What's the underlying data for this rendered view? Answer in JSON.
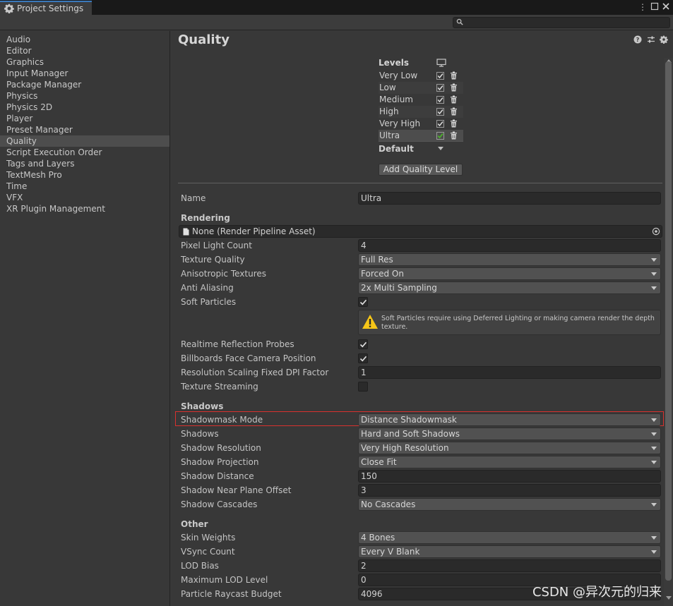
{
  "window": {
    "tab_title": "Project Settings",
    "tab_icon": "gear-icon",
    "menu_icon": "kebab-menu-icon",
    "maximize_icon": "maximize-icon",
    "close_icon": "close-icon"
  },
  "search": {
    "placeholder": "",
    "icon": "search-icon"
  },
  "sidebar": {
    "items": [
      {
        "label": "Audio"
      },
      {
        "label": "Editor"
      },
      {
        "label": "Graphics"
      },
      {
        "label": "Input Manager"
      },
      {
        "label": "Package Manager"
      },
      {
        "label": "Physics"
      },
      {
        "label": "Physics 2D"
      },
      {
        "label": "Player"
      },
      {
        "label": "Preset Manager"
      },
      {
        "label": "Quality",
        "selected": true
      },
      {
        "label": "Script Execution Order"
      },
      {
        "label": "Tags and Layers"
      },
      {
        "label": "TextMesh Pro"
      },
      {
        "label": "Time"
      },
      {
        "label": "VFX"
      },
      {
        "label": "XR Plugin Management"
      }
    ]
  },
  "main": {
    "title": "Quality",
    "header_icons": [
      "help-icon",
      "presets-icon",
      "settings-icon"
    ],
    "levels": {
      "title": "Levels",
      "rows": [
        {
          "name": "Very Low",
          "checked": true
        },
        {
          "name": "Low",
          "checked": true
        },
        {
          "name": "Medium",
          "checked": true
        },
        {
          "name": "High",
          "checked": true
        },
        {
          "name": "Very High",
          "checked": true
        },
        {
          "name": "Ultra",
          "checked": true,
          "selected": true
        }
      ],
      "default_label": "Default",
      "add_button": "Add Quality Level"
    },
    "name": {
      "label": "Name",
      "value": "Ultra"
    },
    "rendering": {
      "header": "Rendering",
      "pipeline_asset": "None (Render Pipeline Asset)",
      "pixel_light_count": {
        "label": "Pixel Light Count",
        "value": "4"
      },
      "texture_quality": {
        "label": "Texture Quality",
        "value": "Full Res"
      },
      "anisotropic_textures": {
        "label": "Anisotropic Textures",
        "value": "Forced On"
      },
      "anti_aliasing": {
        "label": "Anti Aliasing",
        "value": "2x Multi Sampling"
      },
      "soft_particles": {
        "label": "Soft Particles",
        "checked": true
      },
      "soft_particles_warning": "Soft Particles require using Deferred Lighting or making camera render the depth texture.",
      "realtime_reflection_probes": {
        "label": "Realtime Reflection Probes",
        "checked": true
      },
      "billboards_face_camera": {
        "label": "Billboards Face Camera Position",
        "checked": true
      },
      "resolution_scaling_dpi": {
        "label": "Resolution Scaling Fixed DPI Factor",
        "value": "1"
      },
      "texture_streaming": {
        "label": "Texture Streaming",
        "checked": false
      }
    },
    "shadows": {
      "header": "Shadows",
      "shadowmask_mode": {
        "label": "Shadowmask Mode",
        "value": "Distance Shadowmask"
      },
      "shadows": {
        "label": "Shadows",
        "value": "Hard and Soft Shadows"
      },
      "shadow_resolution": {
        "label": "Shadow Resolution",
        "value": "Very High Resolution"
      },
      "shadow_projection": {
        "label": "Shadow Projection",
        "value": "Close Fit"
      },
      "shadow_distance": {
        "label": "Shadow Distance",
        "value": "150"
      },
      "shadow_near_plane_offset": {
        "label": "Shadow Near Plane Offset",
        "value": "3"
      },
      "shadow_cascades": {
        "label": "Shadow Cascades",
        "value": "No Cascades"
      }
    },
    "other": {
      "header": "Other",
      "skin_weights": {
        "label": "Skin Weights",
        "value": "4 Bones"
      },
      "vsync_count": {
        "label": "VSync Count",
        "value": "Every V Blank"
      },
      "lod_bias": {
        "label": "LOD Bias",
        "value": "2"
      },
      "max_lod_level": {
        "label": "Maximum LOD Level",
        "value": "0"
      },
      "particle_raycast_budget": {
        "label": "Particle Raycast Budget",
        "value": "4096"
      }
    }
  },
  "watermark": "CSDN @异次元的归来",
  "colors": {
    "highlight_border": "#d8312e",
    "selected_check": "#4caf2b",
    "warning_yellow": "#f5c518"
  }
}
